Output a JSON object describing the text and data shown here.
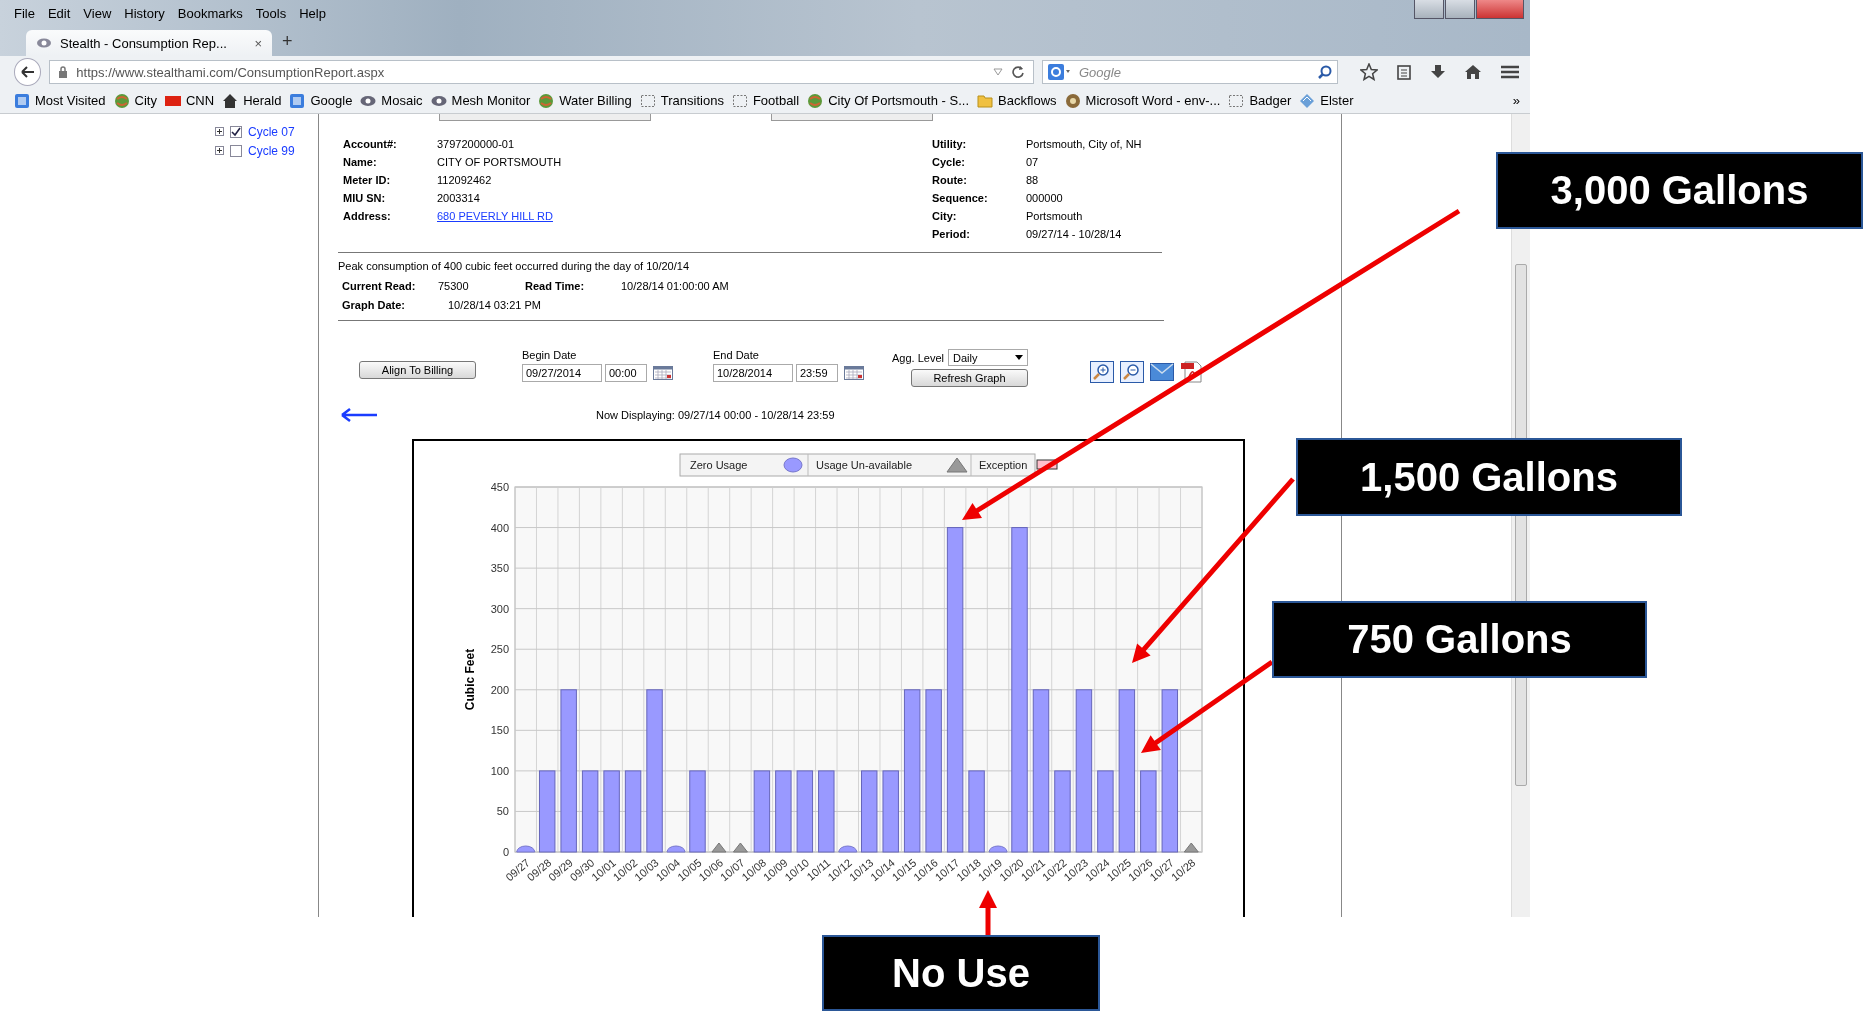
{
  "browser": {
    "menu": [
      "File",
      "Edit",
      "View",
      "History",
      "Bookmarks",
      "Tools",
      "Help"
    ],
    "tab": {
      "title": "Stealth - Consumption Rep...",
      "close": "×"
    },
    "new_tab": "+",
    "url": "https://www.stealthami.com/ConsumptionReport.aspx",
    "search": {
      "placeholder": "Google"
    },
    "bookmarks": [
      {
        "label": "Most Visited",
        "kind": "square"
      },
      {
        "label": "City",
        "kind": "globe"
      },
      {
        "label": "CNN",
        "kind": "red"
      },
      {
        "label": "Herald",
        "kind": "house"
      },
      {
        "label": "Google",
        "kind": "square"
      },
      {
        "label": "Mosaic",
        "kind": "eye"
      },
      {
        "label": "Mesh Monitor",
        "kind": "eye"
      },
      {
        "label": "Water Billing",
        "kind": "globe"
      },
      {
        "label": "Transitions",
        "kind": "page"
      },
      {
        "label": "Football",
        "kind": "page"
      },
      {
        "label": "City Of Portsmouth - S...",
        "kind": "globe"
      },
      {
        "label": "Backflows",
        "kind": "folder"
      },
      {
        "label": "Microsoft Word - env-...",
        "kind": "disc"
      },
      {
        "label": "Badger",
        "kind": "page"
      },
      {
        "label": "Elster",
        "kind": "diamond"
      }
    ],
    "overflow": "»"
  },
  "tree": [
    {
      "label": "Cycle 07",
      "checked": true
    },
    {
      "label": "Cycle 99",
      "checked": false
    }
  ],
  "account": {
    "left": [
      {
        "label": "Account#:",
        "value": "3797200000-01"
      },
      {
        "label": "Name:",
        "value": "CITY OF PORTSMOUTH"
      },
      {
        "label": "Meter ID:",
        "value": "112092462"
      },
      {
        "label": "MIU SN:",
        "value": "2003314"
      },
      {
        "label": "Address:",
        "value": "680 PEVERLY HILL RD",
        "kind": "link"
      }
    ],
    "right": [
      {
        "label": "Utility:",
        "value": "Portsmouth, City of, NH"
      },
      {
        "label": "Cycle:",
        "value": "07"
      },
      {
        "label": "Route:",
        "value": "88"
      },
      {
        "label": "Sequence:",
        "value": "000000"
      },
      {
        "label": "City:",
        "value": "Portsmouth"
      },
      {
        "label": "Period:",
        "value": "09/27/14 - 10/28/14"
      }
    ]
  },
  "peak_text": "Peak consumption of 400 cubic feet occurred during the day of 10/20/14",
  "reads": [
    {
      "label": "Current Read:",
      "value": "75300"
    },
    {
      "label": "Read Time:",
      "value": "10/28/14 01:00:00 AM"
    }
  ],
  "graph_date": {
    "label": "Graph Date:",
    "value": "10/28/14 03:21 PM"
  },
  "controls": {
    "align_button": "Align To Billing",
    "begin": {
      "label": "Begin Date",
      "date": "09/27/2014",
      "time": "00:00"
    },
    "end": {
      "label": "End Date",
      "date": "10/28/2014",
      "time": "23:59"
    },
    "agg": {
      "label": "Agg. Level",
      "value": "Daily"
    },
    "refresh_button": "Refresh Graph"
  },
  "now_displaying": "Now Displaying: 09/27/14 00:00 - 10/28/14 23:59",
  "legend": [
    {
      "label": "Zero Usage",
      "kind": "circle"
    },
    {
      "label": "Usage Un-available",
      "kind": "triangle"
    },
    {
      "label": "Exception",
      "kind": "rect"
    }
  ],
  "chart_data": {
    "type": "bar",
    "grid": true,
    "ylabel": "Cubic Feet",
    "ylim": [
      0,
      450
    ],
    "yticks": [
      0,
      50,
      100,
      150,
      200,
      250,
      300,
      350,
      400,
      450
    ],
    "categories": [
      "09/27",
      "09/28",
      "09/29",
      "09/30",
      "10/01",
      "10/02",
      "10/03",
      "10/04",
      "10/05",
      "10/06",
      "10/07",
      "10/08",
      "10/09",
      "10/10",
      "10/11",
      "10/12",
      "10/13",
      "10/14",
      "10/15",
      "10/16",
      "10/17",
      "10/18",
      "10/19",
      "10/20",
      "10/21",
      "10/22",
      "10/23",
      "10/24",
      "10/25",
      "10/26",
      "10/27",
      "10/28"
    ],
    "values": [
      0,
      100,
      200,
      100,
      100,
      100,
      200,
      0,
      100,
      null,
      null,
      100,
      100,
      100,
      100,
      0,
      100,
      100,
      200,
      200,
      400,
      100,
      0,
      400,
      200,
      100,
      200,
      100,
      200,
      100,
      200,
      null
    ]
  },
  "annotations": [
    {
      "text": "3,000 Gallons"
    },
    {
      "text": "1,500 Gallons"
    },
    {
      "text": "750 Gallons"
    },
    {
      "text": "No Use"
    }
  ]
}
